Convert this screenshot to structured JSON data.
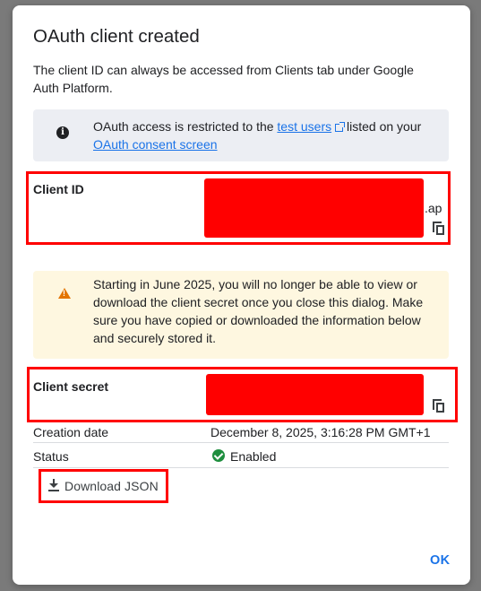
{
  "dialog": {
    "title": "OAuth client created",
    "description": "The client ID can always be accessed from Clients tab under Google Auth Platform.",
    "ok_label": "OK"
  },
  "info": {
    "icon": "info-icon",
    "text_before": "OAuth access is restricted to the ",
    "link1": "test users",
    "text_middle": " listed on your ",
    "link2": "OAuth consent screen"
  },
  "client_id": {
    "label": "Client ID",
    "suffix": ".ap",
    "redacted": true
  },
  "warning": {
    "icon": "warning-icon",
    "text": "Starting in June 2025, you will no longer be able to view or download the client secret once you close this dialog. Make sure you have copied or downloaded the information below and securely stored it."
  },
  "client_secret": {
    "label": "Client secret",
    "redacted": true
  },
  "details": {
    "creation_label": "Creation date",
    "creation_value": "December 8, 2025, 3:16:28 PM GMT+1",
    "status_label": "Status",
    "status_value": "Enabled"
  },
  "download": {
    "label": "Download JSON",
    "icon": "download-icon"
  },
  "colors": {
    "accent": "#1a73e8",
    "redaction": "#ff0000",
    "status_ok": "#1e8e3e",
    "warning": "#e37400"
  }
}
